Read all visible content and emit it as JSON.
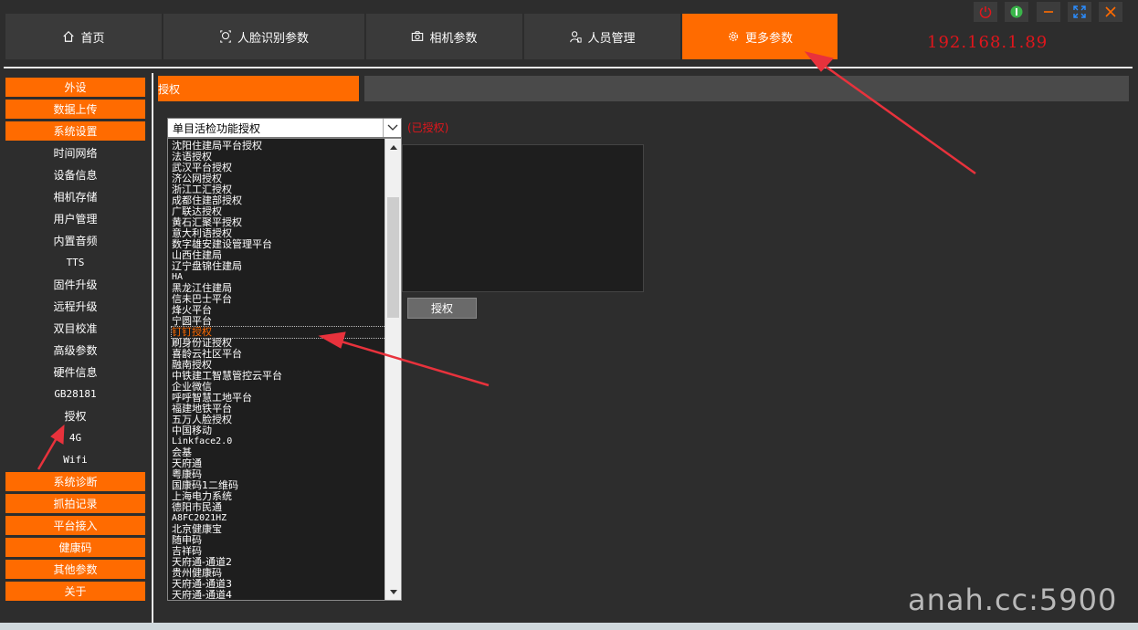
{
  "tabs": [
    {
      "label": "首页",
      "icon": "home-icon"
    },
    {
      "label": "人脸识别参数",
      "icon": "face-icon"
    },
    {
      "label": "相机参数",
      "icon": "camera-icon"
    },
    {
      "label": "人员管理",
      "icon": "user-icon"
    },
    {
      "label": "更多参数",
      "icon": "gear-icon",
      "active": true
    }
  ],
  "window_controls": [
    "power-icon",
    "toggle-icon",
    "minimize-icon",
    "fullscreen-icon",
    "close-icon"
  ],
  "ip_address": "192.168.1.89",
  "sidebar": {
    "top_items": [
      "外设",
      "数据上传",
      "系统设置"
    ],
    "sub_items": [
      "时间网络",
      "设备信息",
      "相机存储",
      "用户管理",
      "内置音频",
      "TTS",
      "固件升级",
      "远程升级",
      "双目校准",
      "高级参数",
      "硬件信息",
      "GB28181",
      "授权",
      "4G",
      "Wifi"
    ],
    "bottom_items": [
      "系统诊断",
      "抓拍记录",
      "平台接入",
      "健康码",
      "其他参数",
      "关于"
    ]
  },
  "section_title": "授权",
  "combo": {
    "value": "单目活检功能授权"
  },
  "status_text": "(已授权)",
  "authorize_button": "授权",
  "list_items": [
    "沈阳住建局平台授权",
    "法语授权",
    "武汉平台授权",
    "济公网授权",
    "浙江工汇授权",
    "成都住建部授权",
    "广联达授权",
    "黄石汇聚平授权",
    "意大利语授权",
    "数字雄安建设管理平台",
    "山西住建局",
    "辽宁盘锦住建局",
    "HA",
    "黑龙江住建局",
    "信未巴士平台",
    "烽火平台",
    "宁圆平台",
    "钉钉授权",
    "刷身份证授权",
    "喜龄云社区平台",
    "融南授权",
    "中铁建工智慧管控云平台",
    "企业微信",
    "呼呼智慧工地平台",
    "福建地铁平台",
    "五万人脸授权",
    "中国移动",
    "Linkface2.0",
    "会基",
    "天府通",
    "粤康码",
    "国康码1二维码",
    "上海电力系统",
    "德阳市民通",
    "A8FC2021HZ",
    "北京健康宝",
    "随申码",
    "吉祥码",
    "天府通-通道2",
    "贵州健康码",
    "天府通-通道3",
    "天府通-通道4"
  ],
  "selected_index": 17,
  "watermark": "anah.cc:5900",
  "colors": {
    "accent": "#ff6b00",
    "panel": "#2d2d2d",
    "annotation_red": "#e8323c"
  }
}
